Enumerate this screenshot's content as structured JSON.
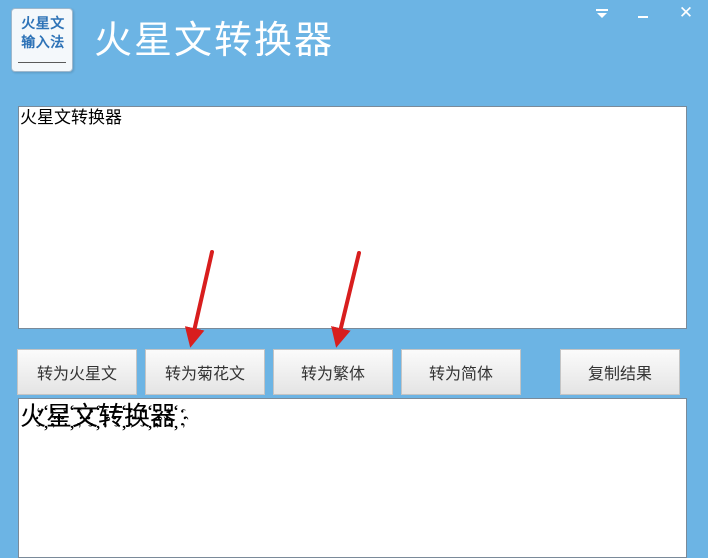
{
  "header": {
    "logo_text": "火星文\n输入法",
    "title": "火星文转换器"
  },
  "window_controls": {
    "menu_icon": "dropdown-icon",
    "minimize_icon": "minimize-icon",
    "close_icon": "close-icon",
    "close_glyph": "✕"
  },
  "input": {
    "value": "火星文转换器"
  },
  "buttons": {
    "to_martian": "转为火星文",
    "to_chrysanthemum": "转为菊花文",
    "to_traditional": "转为繁体",
    "to_simplified": "转为简体",
    "copy_result": "复制结果"
  },
  "output": {
    "value": "火҉星҉文҉转҉换҉器҉"
  },
  "colors": {
    "background": "#6cb4e4",
    "arrow": "#d81e1e"
  }
}
